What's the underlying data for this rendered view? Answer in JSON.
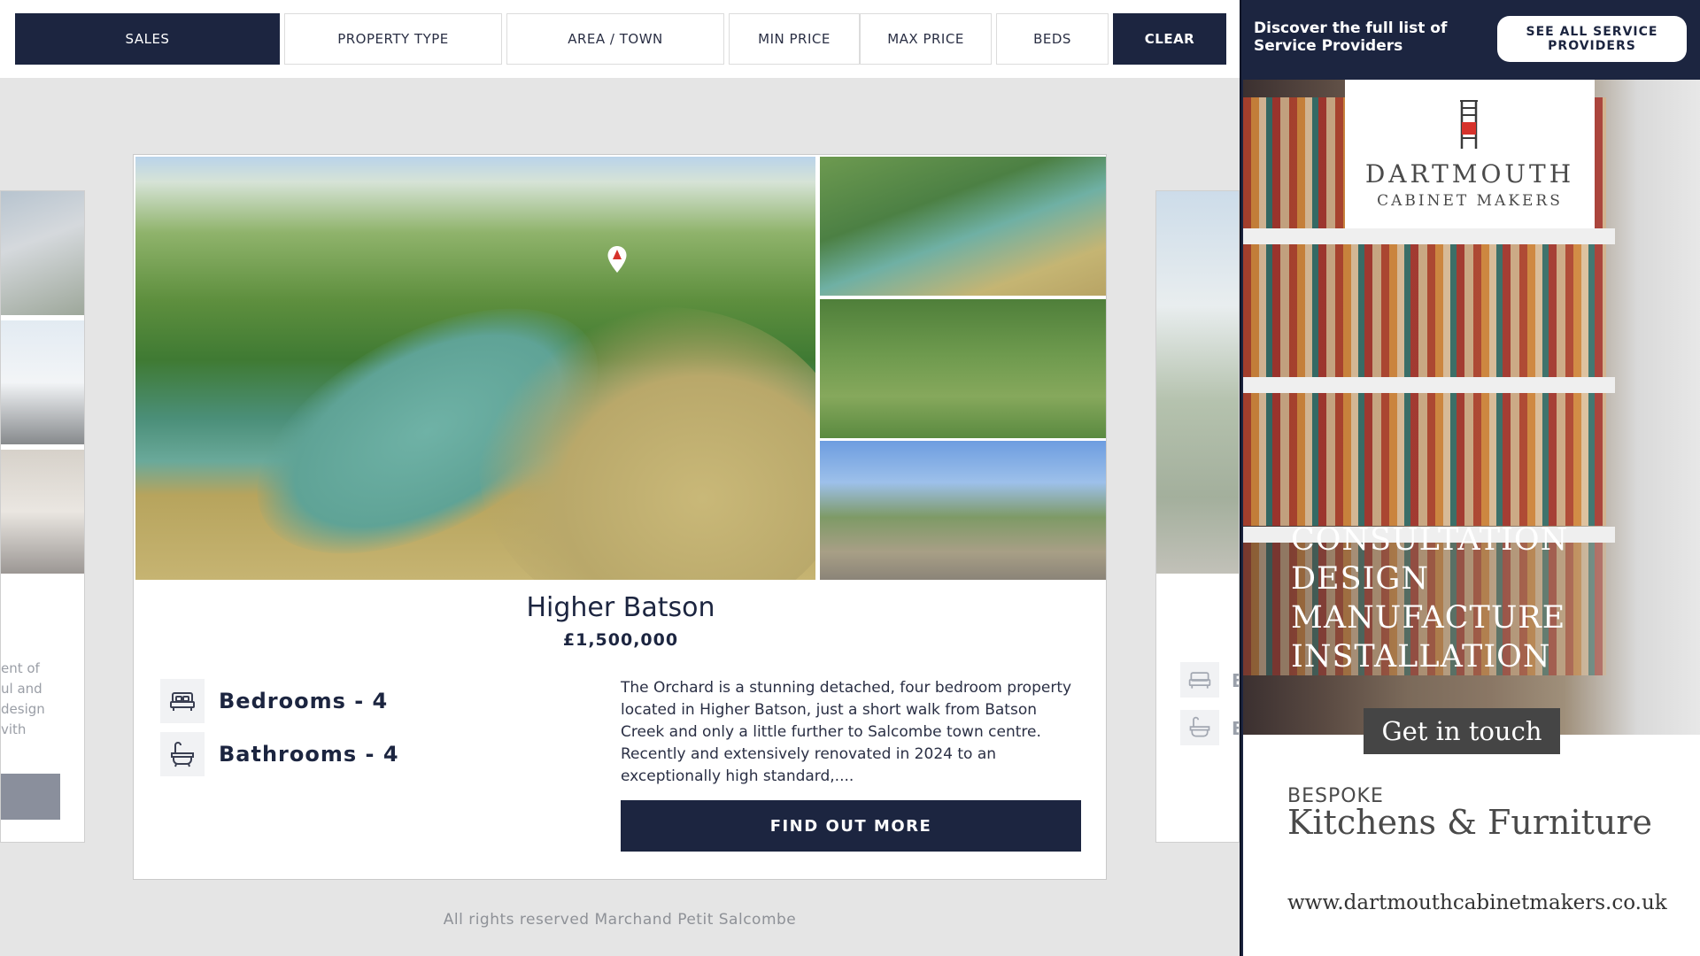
{
  "filters": {
    "sales": "SALES",
    "property_type": "PROPERTY TYPE",
    "area_town": "AREA / TOWN",
    "min_price": "MIN PRICE",
    "max_price": "MAX PRICE",
    "beds": "BEDS",
    "clear": "CLEAR"
  },
  "left_peek": {
    "text": "ent of\nul and\ndesign\nvith"
  },
  "right_peek": {
    "bed_label": "B",
    "bath_label": "B"
  },
  "listing": {
    "title": "Higher Batson",
    "price": "£1,500,000",
    "bedrooms": "Bedrooms - 4",
    "bathrooms": "Bathrooms - 4",
    "description": "The Orchard is a stunning detached, four bedroom property located in Higher Batson, just a short walk from Batson Creek and only a little further to Salcombe town centre. Recently and extensively renovated in 2024 to an exceptionally high standard,....",
    "cta": "FIND OUT MORE"
  },
  "footer": {
    "text": "All rights reserved Marchand Petit Salcombe"
  },
  "sidebar": {
    "heading": "Discover the full list of Service Providers",
    "button": "SEE ALL SERVICE PROVIDERS"
  },
  "ad": {
    "brand_line1": "DARTMOUTH",
    "brand_line2": "CABINET MAKERS",
    "services": [
      "CONSULTATION",
      "DESIGN",
      "MANUFACTURE",
      "INSTALLATION"
    ],
    "cta": "Get in touch",
    "bespoke": "BESPOKE",
    "tagline": "Kitchens & Furniture",
    "url": "www.dartmouthcabinetmakers.co.uk"
  },
  "colors": {
    "navy": "#1c2540",
    "page_bg": "#e5e5e5"
  },
  "icons": [
    "bed-icon",
    "bath-icon",
    "location-marker-icon",
    "chair-logo-icon"
  ]
}
